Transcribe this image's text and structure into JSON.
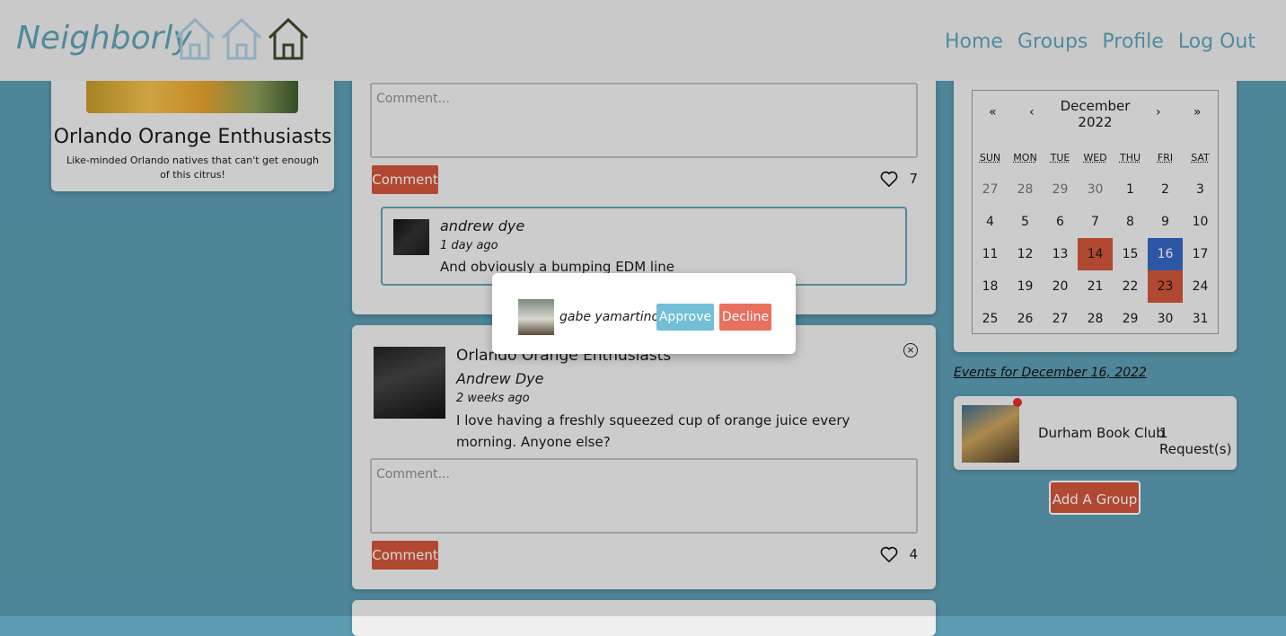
{
  "header": {
    "brand": "Neighborly",
    "nav": [
      "Home",
      "Groups",
      "Profile",
      "Log Out"
    ]
  },
  "group_card": {
    "name": "Orlando Orange Enthusiasts",
    "description": "Like-minded Orlando natives that can't get enough of this citrus!"
  },
  "post1": {
    "comment_placeholder": "Comment...",
    "comment_button": "Comment",
    "likes": "7",
    "reply": {
      "name": "andrew dye",
      "time": "1 day ago",
      "text": "And obviously a bumping EDM line"
    }
  },
  "post2": {
    "group": "Orlando Orange Enthusiasts",
    "author": "Andrew Dye",
    "time": "2 weeks ago",
    "body": "I love having a freshly squeezed cup of orange juice every morning. Anyone else?",
    "comment_placeholder": "Comment...",
    "comment_button": "Comment",
    "likes": "4"
  },
  "calendar": {
    "month": "December",
    "year": "2022",
    "nav": {
      "prev_year": "«",
      "prev": "‹",
      "next": "›",
      "next_year": "»"
    },
    "weekdays": [
      "SUN",
      "MON",
      "TUE",
      "WED",
      "THU",
      "FRI",
      "SAT"
    ],
    "days": [
      "27",
      "28",
      "29",
      "30",
      "1",
      "2",
      "3",
      "4",
      "5",
      "6",
      "7",
      "8",
      "9",
      "10",
      "11",
      "12",
      "13",
      "14",
      "15",
      "16",
      "17",
      "18",
      "19",
      "20",
      "21",
      "22",
      "23",
      "24",
      "25",
      "26",
      "27",
      "28",
      "29",
      "30",
      "31"
    ],
    "selected": "16",
    "event_days": [
      "14",
      "23"
    ]
  },
  "events_link": "Events for December 16, 2022",
  "request_card": {
    "group": "Durham Book Club",
    "count": "1 Request(s)"
  },
  "add_group_button": "Add A Group",
  "modal": {
    "name": "gabe yamartino",
    "approve": "Approve",
    "decline": "Decline"
  },
  "colors": {
    "accent": "#5fa3b8",
    "action": "#d0553a",
    "selected": "#3567c4",
    "approve": "#72bfd6",
    "decline": "#e8705e"
  }
}
